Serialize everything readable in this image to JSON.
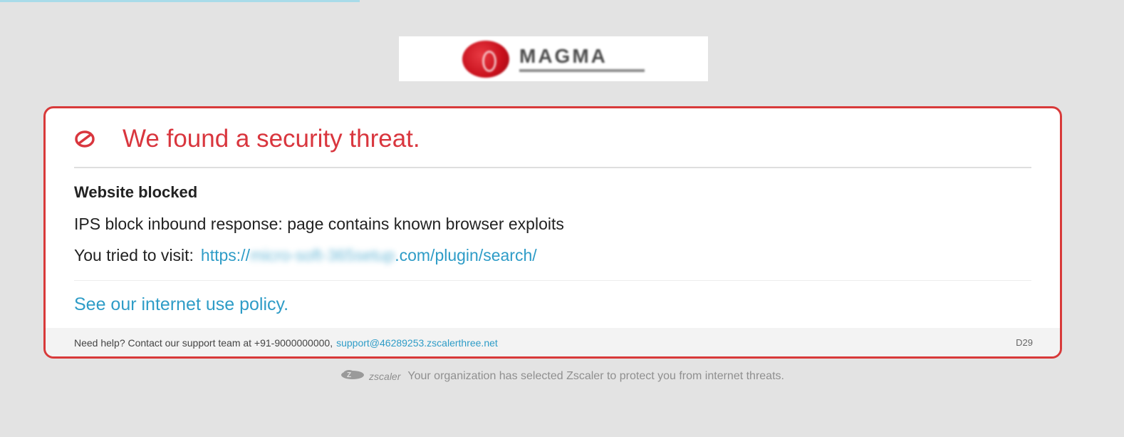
{
  "logo": {
    "text": "MAGMA"
  },
  "alert": {
    "title": "We found a security threat.",
    "section_title": "Website blocked",
    "reason": "IPS block inbound response: page contains known browser exploits",
    "visit_label": "You tried to visit:",
    "url_prefix": "https://",
    "url_hidden": "micro-soft-365setup",
    "url_suffix": ".com/plugin/search/",
    "policy_link": "See our internet use policy.",
    "help_text": "Need help? Contact our support team at +91-9000000000,",
    "support_email": "support@46289253.zscalerthree.net",
    "error_code": "D29"
  },
  "footer": {
    "brand": "zscaler",
    "message": "Your organization has selected Zscaler to protect you from internet threats."
  },
  "colors": {
    "alert_red": "#d9363e",
    "link_blue": "#2e9cc7",
    "background": "#e3e3e3"
  },
  "icons": {
    "block": "block-icon",
    "zscaler_cloud": "zscaler-cloud-icon"
  }
}
